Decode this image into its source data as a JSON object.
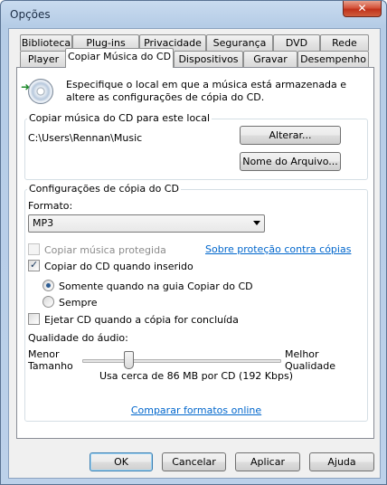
{
  "window": {
    "title": "Opções",
    "close_glyph": "✕"
  },
  "tabs_top": [
    "Biblioteca",
    "Plug-ins",
    "Privacidade",
    "Segurança",
    "DVD",
    "Rede"
  ],
  "tabs_bottom": [
    "Player",
    "Copiar Música do CD",
    "Dispositivos",
    "Gravar",
    "Desempenho"
  ],
  "active_tab": "Copiar Música do CD",
  "intro_text": "Especifique o local em que a música está armazenada e altere as configurações de cópia do CD.",
  "location_group": {
    "label": "Copiar música do CD para este local",
    "path": "C:\\Users\\Rennan\\Music",
    "change_button": "Alterar...",
    "filename_button": "Nome do Arquivo..."
  },
  "settings_group": {
    "label": "Configurações de cópia do CD",
    "format_label": "Formato:",
    "format_value": "MP3",
    "protect_label": "Copiar música protegida",
    "protect_checked": false,
    "protect_link": "Sobre proteção contra cópias",
    "auto_rip_label": "Copiar do CD quando inserido",
    "auto_rip_checked": true,
    "radio_only_tab": "Somente quando na guia Copiar do CD",
    "radio_always": "Sempre",
    "radio_selected": "only_tab",
    "eject_label": "Ejetar CD quando a cópia for concluída",
    "eject_checked": false,
    "quality_label": "Qualidade do áudio:",
    "min_label": "Menor Tamanho",
    "max_label": "Melhor Qualidade",
    "quality_level": 0.22,
    "usage_text": "Usa cerca de 86 MB por CD (192 Kbps)",
    "compare_link": "Comparar formatos online"
  },
  "buttons": {
    "ok": "OK",
    "cancel": "Cancelar",
    "apply": "Aplicar",
    "help": "Ajuda"
  },
  "icons": {
    "cd": "cd-rip-icon",
    "dropdown": "chevron-down-icon"
  }
}
